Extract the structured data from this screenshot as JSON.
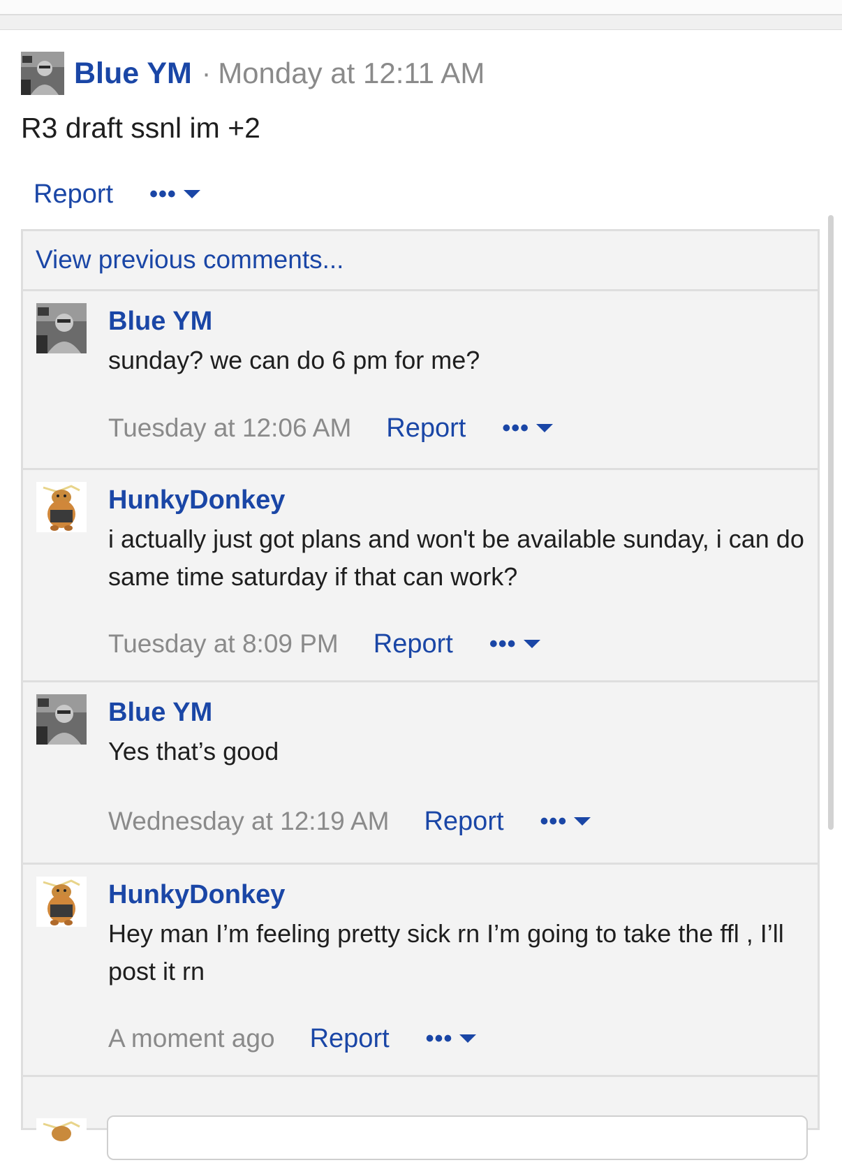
{
  "post": {
    "author": "Blue YM",
    "separator": "·",
    "time": "Monday at 12:11 AM",
    "body": "R3 draft ssnl im +2",
    "report_label": "Report",
    "more_label": "•••"
  },
  "comments_section": {
    "view_previous_label": "View previous comments...",
    "comments": [
      {
        "author": "Blue YM",
        "avatar": "photo-avatar",
        "text": "sunday? we can do 6 pm for me?",
        "time": "Tuesday at 12:06 AM",
        "report_label": "Report",
        "more_label": "•••"
      },
      {
        "author": "HunkyDonkey",
        "avatar": "cartoon-avatar",
        "text": "i actually just got plans and won't be available sunday, i can do same time saturday if that can work?",
        "time": "Tuesday at 8:09 PM",
        "report_label": "Report",
        "more_label": "•••"
      },
      {
        "author": "Blue YM",
        "avatar": "photo-avatar",
        "text": "Yes that’s good",
        "time": "Wednesday at 12:19 AM",
        "report_label": "Report",
        "more_label": "•••"
      },
      {
        "author": "HunkyDonkey",
        "avatar": "cartoon-avatar",
        "text": "Hey man I’m feeling pretty sick rn I’m going to take the ffl , I’ll post it rn",
        "time": "A moment ago",
        "report_label": "Report",
        "more_label": "•••"
      }
    ]
  },
  "colors": {
    "link": "#1a46a6",
    "muted": "#8a8a8a",
    "comment_bg": "#f3f3f3"
  }
}
